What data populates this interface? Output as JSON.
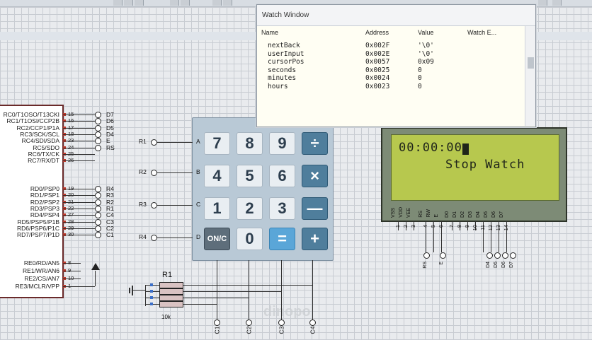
{
  "watch_window": {
    "title": "Watch Window",
    "columns": [
      "Name",
      "Address",
      "Value",
      "Watch E..."
    ],
    "rows": [
      {
        "name": "nextBack",
        "address": "0x002F",
        "value": "'\\0'"
      },
      {
        "name": "userInput",
        "address": "0x002E",
        "value": "'\\0'"
      },
      {
        "name": "cursorPos",
        "address": "0x0057",
        "value": "0x09"
      },
      {
        "name": "seconds",
        "address": "0x0025",
        "value": "0"
      },
      {
        "name": "minutes",
        "address": "0x0024",
        "value": "0"
      },
      {
        "name": "hours",
        "address": "0x0023",
        "value": "0"
      }
    ]
  },
  "lcd": {
    "line1": "00:00:00",
    "line2": "Stop Watch",
    "pins": [
      "VSS",
      "VDD",
      "VEE",
      "RS",
      "RW",
      "E",
      "D0",
      "D1",
      "D2",
      "D3",
      "D4",
      "D5",
      "D6",
      "D7"
    ],
    "pin_numbers": [
      "1",
      "2",
      "3",
      "4",
      "5",
      "6",
      "7",
      "8",
      "9",
      "10",
      "11",
      "12",
      "13",
      "14"
    ],
    "bottom_labels": [
      "RS",
      "E",
      "D4",
      "D5",
      "D6",
      "D7"
    ]
  },
  "keypad": {
    "rows": [
      [
        "7",
        "8",
        "9",
        "÷"
      ],
      [
        "4",
        "5",
        "6",
        "×"
      ],
      [
        "1",
        "2",
        "3",
        "—"
      ],
      [
        "ON/C",
        "0",
        "=",
        "+"
      ]
    ],
    "row_letters": [
      "A",
      "B",
      "C",
      "D"
    ],
    "row_nets": [
      "R1",
      "R2",
      "R3",
      "R4"
    ],
    "col_nets": [
      "C1",
      "C2",
      "C3",
      "C4"
    ]
  },
  "mcu": {
    "portc": [
      {
        "label": "RC0/T1OSO/T13CKI",
        "pin": "15",
        "net": "D7"
      },
      {
        "label": "RC1/T1OSI/CCP2B",
        "pin": "16",
        "net": "D6"
      },
      {
        "label": "RC2/CCP1/P1A",
        "pin": "17",
        "net": "D5"
      },
      {
        "label": "RC3/SCK/SCL",
        "pin": "18",
        "net": "D4"
      },
      {
        "label": "RC4/SDI/SDA",
        "pin": "23",
        "net": "E"
      },
      {
        "label": "RC5/SDO",
        "pin": "24",
        "net": "RS"
      },
      {
        "label": "RC6/TX/CK",
        "pin": "25",
        "net": ""
      },
      {
        "label": "RC7/RX/DT",
        "pin": "26",
        "net": ""
      }
    ],
    "portd": [
      {
        "label": "RD0/PSP0",
        "pin": "19",
        "net": "R4"
      },
      {
        "label": "RD1/PSP1",
        "pin": "20",
        "net": "R3"
      },
      {
        "label": "RD2/PSP2",
        "pin": "21",
        "net": "R2"
      },
      {
        "label": "RD3/PSP3",
        "pin": "22",
        "net": "R1"
      },
      {
        "label": "RD4/PSP4",
        "pin": "27",
        "net": "C4"
      },
      {
        "label": "RD5/PSP5/P1B",
        "pin": "28",
        "net": "C3"
      },
      {
        "label": "RD6/PSP6/P1C",
        "pin": "29",
        "net": "C2"
      },
      {
        "label": "RD7/PSP7/P1D",
        "pin": "30",
        "net": "C1"
      }
    ],
    "porte": [
      {
        "label": "RE0/RD/AN5",
        "pin": "8"
      },
      {
        "label": "RE1/WR/AN6",
        "pin": "9"
      },
      {
        "label": "RE2/CS/AN7",
        "pin": "10"
      },
      {
        "label": "RE3/MCLR/VPP",
        "pin": "1"
      }
    ]
  },
  "resistor_pack": {
    "name": "R1",
    "value": "10k"
  },
  "watermark": "dinopo"
}
